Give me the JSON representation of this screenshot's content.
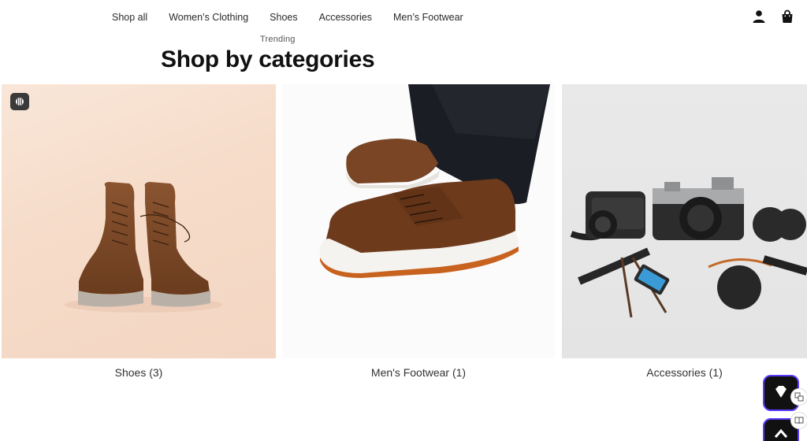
{
  "nav": {
    "links": [
      "Shop all",
      "Women’s Clothing",
      "Shoes",
      "Accessories",
      "Men’s Footwear"
    ],
    "icons": [
      "account-icon",
      "shopping-bag-icon"
    ]
  },
  "section": {
    "eyebrow": "Trending",
    "title": "Shop by categories"
  },
  "categories": [
    {
      "label": "Shoes (3)",
      "image": "brown-leather-high-top-boots"
    },
    {
      "label": "Men's Footwear (1)",
      "image": "brown-leather-sneaker-on-foot"
    },
    {
      "label": "Accessories (1)",
      "image": "cameras-and-accessories-flatlay"
    }
  ],
  "floating": [
    "gem-icon",
    "translate-icon",
    "book-icon"
  ],
  "colors": {
    "accent_border": "#5b3cff",
    "dark": "#111111",
    "badge": "#3a3a3a"
  }
}
